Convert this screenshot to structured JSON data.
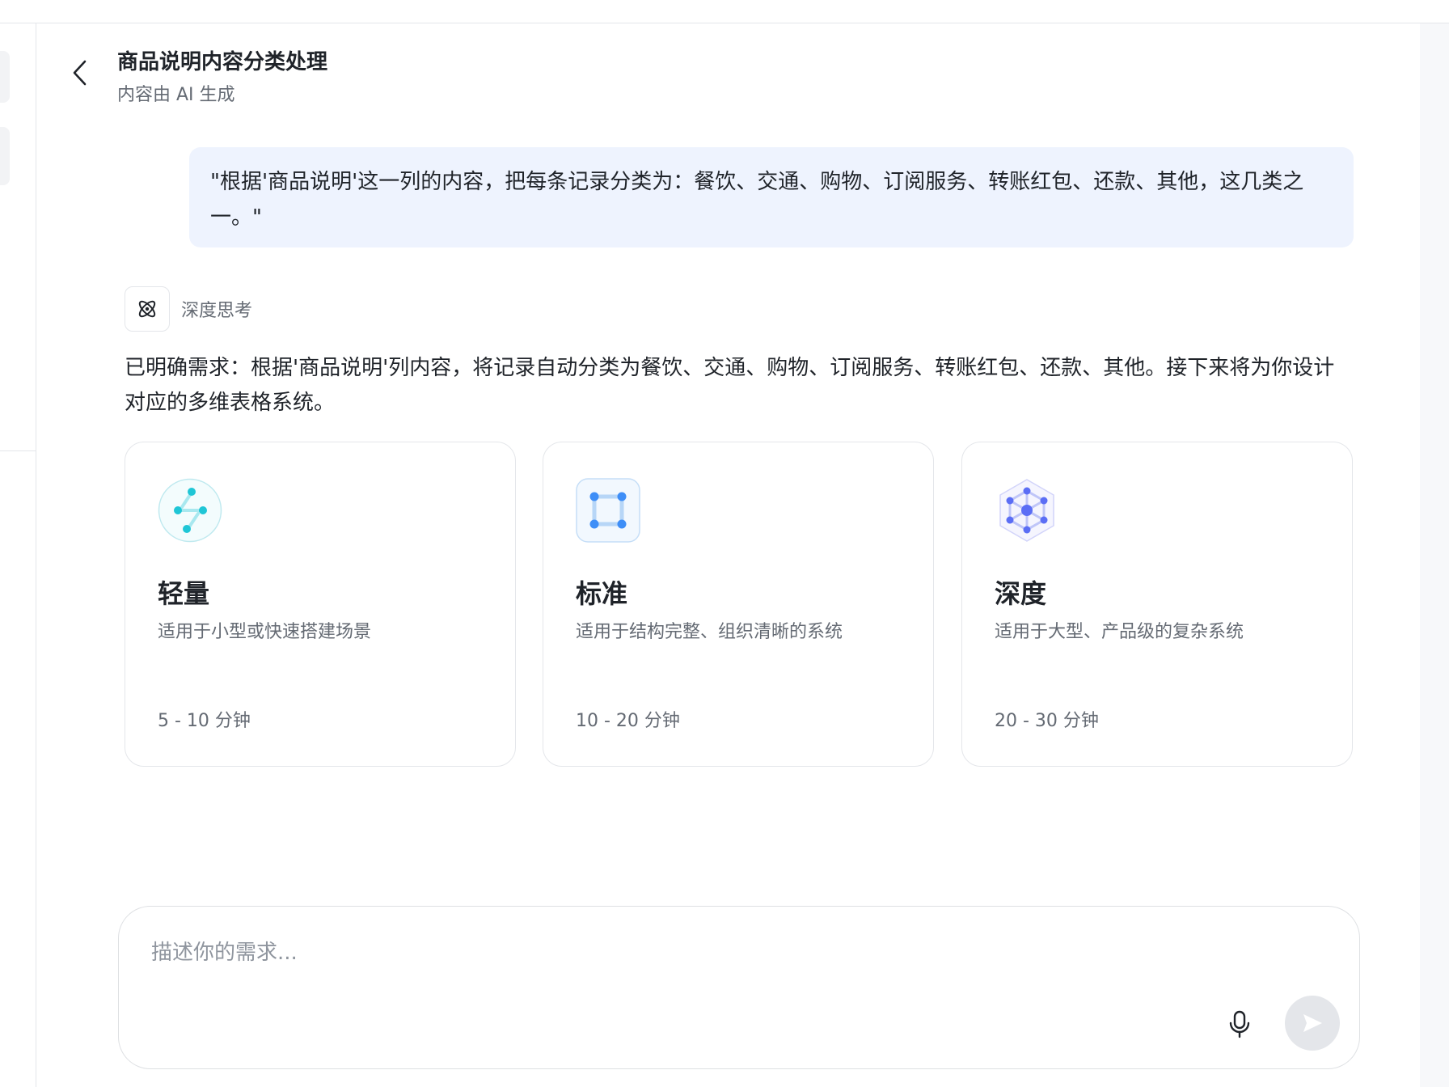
{
  "header": {
    "title": "商品说明内容分类处理",
    "subtitle": "内容由 AI 生成",
    "back_icon": "chevron-left-icon"
  },
  "user_message": "\"根据'商品说明'这一列的内容，把每条记录分类为：餐饮、交通、购物、订阅服务、转账红包、还款、其他，这几类之一。\"",
  "thinking": {
    "icon": "atom-icon",
    "label": "深度思考"
  },
  "assistant_message": "已明确需求：根据'商品说明'列内容，将记录自动分类为餐饮、交通、购物、订阅服务、转账红包、还款、其他。接下来将为你设计对应的多维表格系统。",
  "options": [
    {
      "icon": "lightweight-icon",
      "title": "轻量",
      "description": "适用于小型或快速搭建场景",
      "duration": "5 - 10 分钟",
      "accent": "#1fc6d6"
    },
    {
      "icon": "standard-icon",
      "title": "标准",
      "description": "适用于结构完整、组织清晰的系统",
      "duration": "10 - 20 分钟",
      "accent": "#3e8ef7"
    },
    {
      "icon": "deep-icon",
      "title": "深度",
      "description": "适用于大型、产品级的复杂系统",
      "duration": "20 - 30 分钟",
      "accent": "#5b6ef5"
    }
  ],
  "composer": {
    "placeholder": "描述你的需求...",
    "value": "",
    "mic_icon": "microphone-icon",
    "send_icon": "send-icon"
  },
  "colors": {
    "bubble_bg": "#eef3fe",
    "text_primary": "#1f2329",
    "text_secondary": "#646a73",
    "border": "#e4e6ea"
  }
}
